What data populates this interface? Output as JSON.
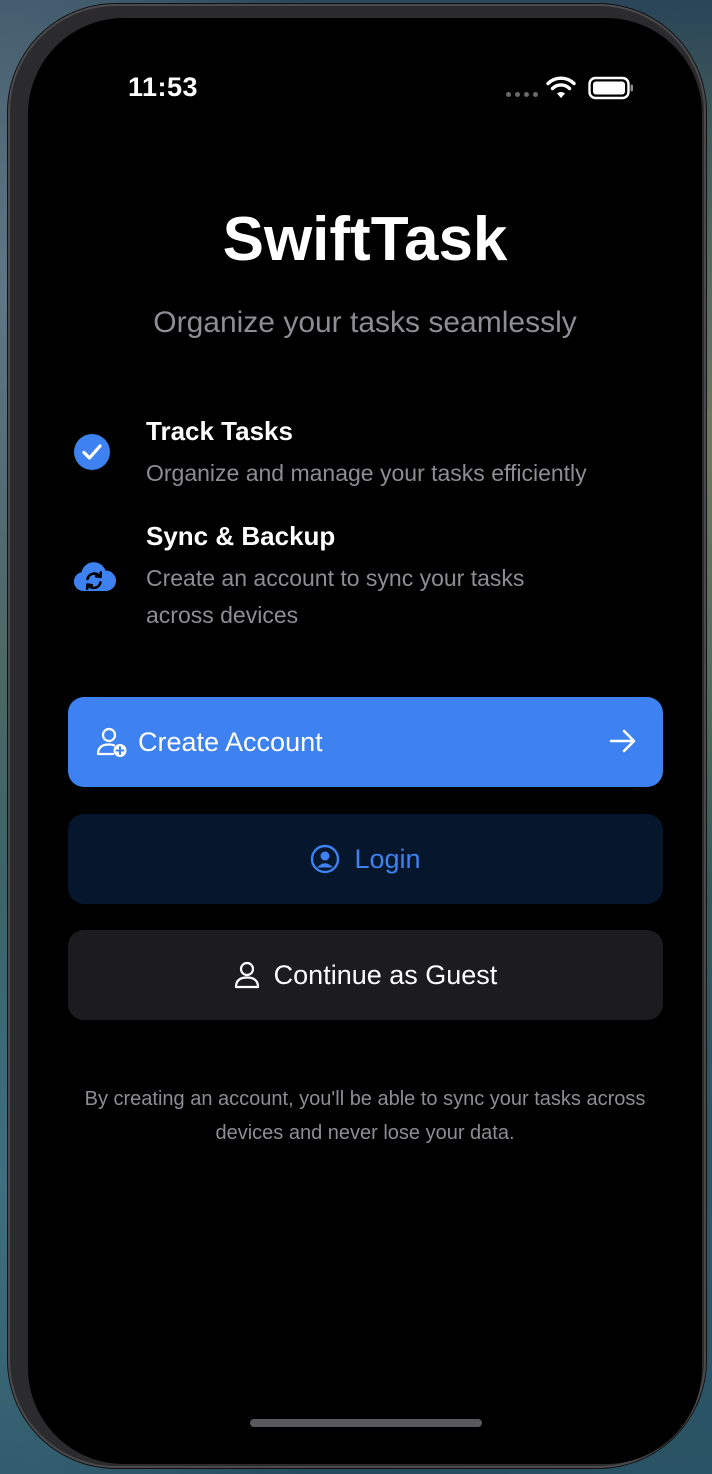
{
  "status_bar": {
    "time": "11:53"
  },
  "app": {
    "title": "SwiftTask",
    "subtitle": "Organize your tasks seamlessly"
  },
  "features": [
    {
      "icon": "checkmark-circle-icon",
      "title": "Track Tasks",
      "description": "Organize and manage your tasks efficiently"
    },
    {
      "icon": "cloud-sync-icon",
      "title": "Sync & Backup",
      "description": "Create an account to sync your tasks across devices"
    }
  ],
  "buttons": {
    "create_account": {
      "label": "Create Account",
      "icon": "person-add-icon",
      "trailing_icon": "arrow-right-icon"
    },
    "login": {
      "label": "Login",
      "icon": "person-circle-icon"
    },
    "guest": {
      "label": "Continue as Guest",
      "icon": "person-icon"
    }
  },
  "footer_note": "By creating an account, you'll be able to sync your tasks across devices and never lose your data.",
  "colors": {
    "accent": "#3d82f0",
    "background": "#000000",
    "secondary_text": "#8d8d93",
    "login_bg": "#06162c",
    "guest_bg": "#1c1c1e"
  }
}
